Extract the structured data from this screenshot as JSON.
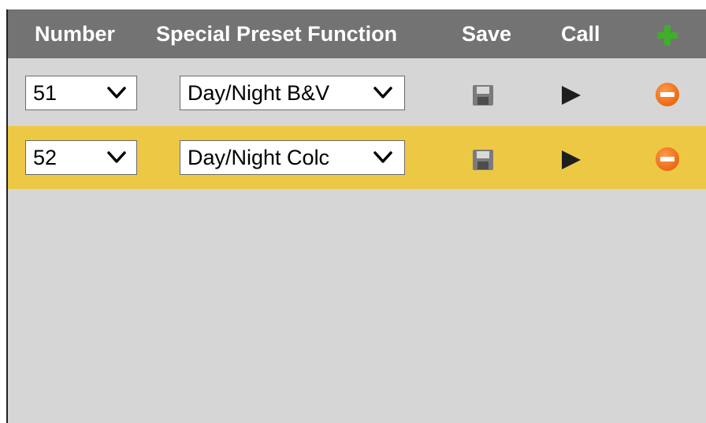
{
  "header": {
    "number_label": "Number",
    "function_label": "Special Preset Function",
    "save_label": "Save",
    "call_label": "Call",
    "add_icon": "plus-icon"
  },
  "rows": [
    {
      "number": "51",
      "function": "Day/Night B&W",
      "function_visible": "Day/Night B&V",
      "save_icon": "floppy-disk-icon",
      "call_icon": "play-icon",
      "remove_icon": "minus-circle-icon",
      "highlighted": false
    },
    {
      "number": "52",
      "function": "Day/Night Color",
      "function_visible": "Day/Night Colc",
      "save_icon": "floppy-disk-icon",
      "call_icon": "play-icon",
      "remove_icon": "minus-circle-icon",
      "highlighted": true
    }
  ],
  "colors": {
    "header_bg": "#737373",
    "panel_bg": "#d6d6d6",
    "highlight_row": "#edc845",
    "add_green": "#3fae2a",
    "remove_orange": "#ec6a12"
  }
}
